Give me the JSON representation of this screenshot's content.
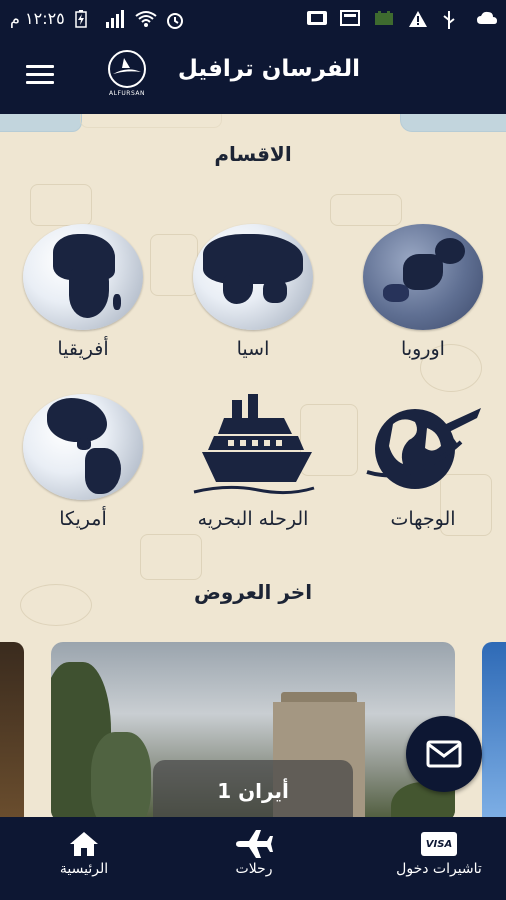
{
  "status_bar": {
    "time": "١٢:٢٥ م"
  },
  "app": {
    "title": "الفرسان ترافيل",
    "logo_text": "ALFURSAN"
  },
  "sections": {
    "categories_title": "الاقسام",
    "offers_title": "اخر العروض"
  },
  "categories": [
    {
      "label": "اوروبا",
      "icon": "europe-globe"
    },
    {
      "label": "اسيا",
      "icon": "asia-globe"
    },
    {
      "label": "أفريقيا",
      "icon": "africa-globe"
    },
    {
      "label": "الوجهات",
      "icon": "globe-plane-icon"
    },
    {
      "label": "الرحله البحريه",
      "icon": "cruise-ship-icon"
    },
    {
      "label": "أمريكا",
      "icon": "americas-globe"
    }
  ],
  "offers": [
    {
      "title": "أيران 1"
    }
  ],
  "bottom_nav": [
    {
      "label": "تاشيرات دخول",
      "icon": "visa-card-icon"
    },
    {
      "label": "رحلات",
      "icon": "airplane-icon"
    },
    {
      "label": "الرئيسية",
      "icon": "home-icon"
    }
  ],
  "colors": {
    "primary": "#0d1733",
    "background": "#efe6d2",
    "text": "#1c2435"
  }
}
